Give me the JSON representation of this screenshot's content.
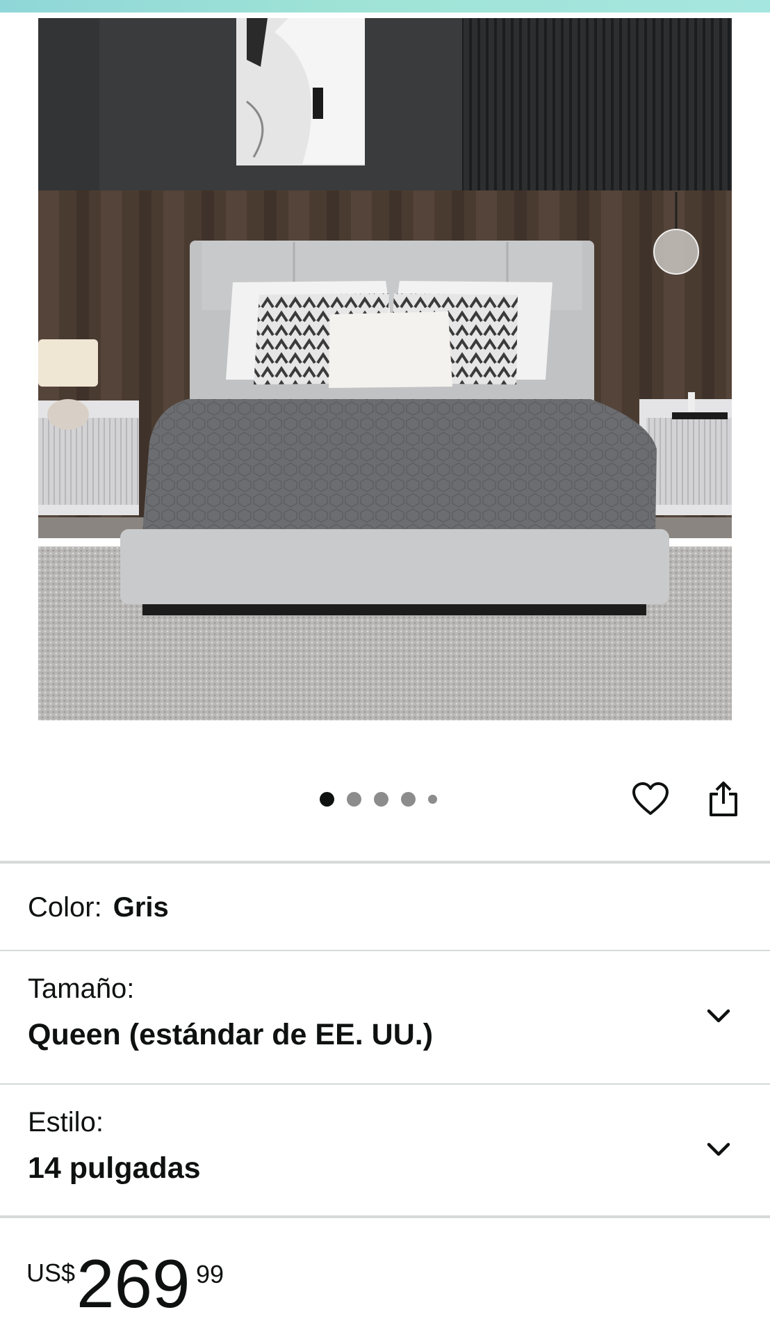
{
  "image_carousel": {
    "dots": 5,
    "active_index": 0
  },
  "actions": {
    "wishlist_icon": "heart-icon",
    "share_icon": "share-icon"
  },
  "variations": {
    "color": {
      "label": "Color:",
      "value": "Gris"
    },
    "size": {
      "label": "Tamaño:",
      "value": "Queen (estándar de EE. UU.)"
    },
    "style": {
      "label": "Estilo:",
      "value": "14 pulgadas"
    }
  },
  "price": {
    "currency": "US$",
    "whole": "269",
    "fraction": "99"
  },
  "colors": {
    "accent_strip": "#9fe3d6",
    "divider": "#d5d9d9",
    "text": "#0f1111"
  }
}
